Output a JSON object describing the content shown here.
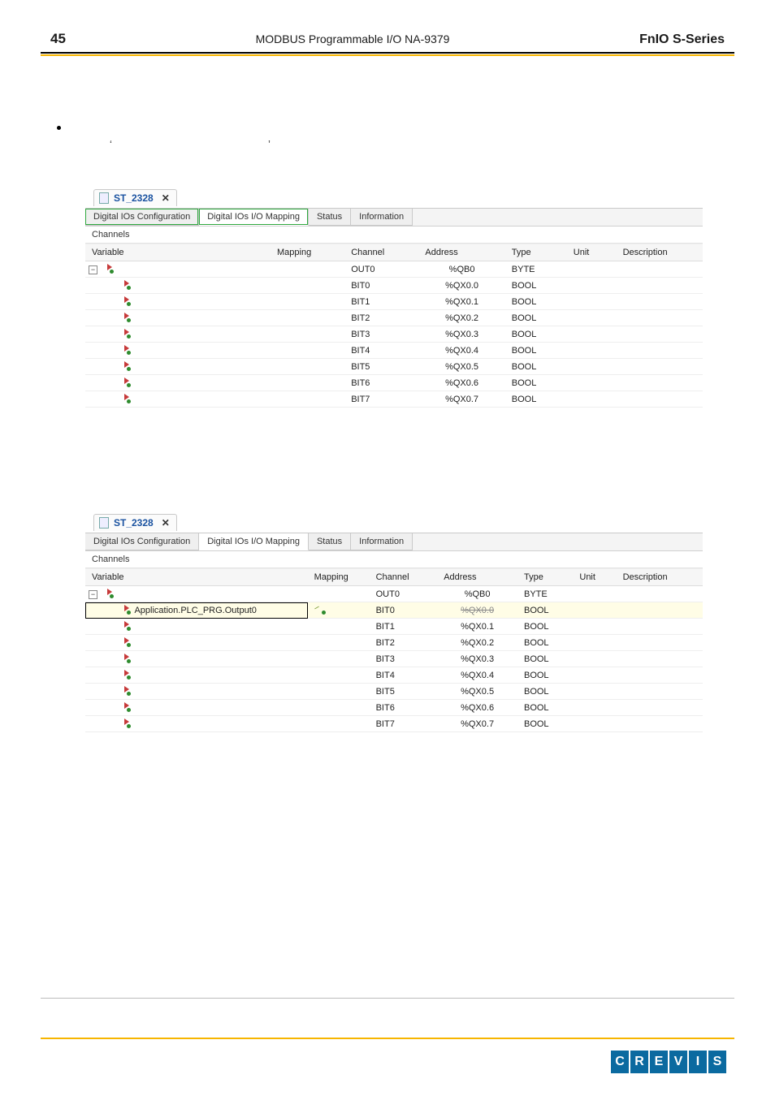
{
  "header": {
    "page_number": "45",
    "doc_title": "MODBUS Programmable I/O NA-9379",
    "series": "FnIO  S-Series"
  },
  "tabs": {
    "file_tab": "ST_2328",
    "config": "Digital IOs Configuration",
    "mapping": "Digital IOs I/O Mapping",
    "status": "Status",
    "info": "Information"
  },
  "section_label": "Channels",
  "columns": {
    "variable": "Variable",
    "mapping": "Mapping",
    "channel": "Channel",
    "address": "Address",
    "type": "Type",
    "unit": "Unit",
    "description": "Description"
  },
  "table1": {
    "parent": {
      "channel": "OUT0",
      "address": "%QB0",
      "type": "BYTE"
    },
    "rows": [
      {
        "channel": "BIT0",
        "address": "%QX0.0",
        "type": "BOOL"
      },
      {
        "channel": "BIT1",
        "address": "%QX0.1",
        "type": "BOOL"
      },
      {
        "channel": "BIT2",
        "address": "%QX0.2",
        "type": "BOOL"
      },
      {
        "channel": "BIT3",
        "address": "%QX0.3",
        "type": "BOOL"
      },
      {
        "channel": "BIT4",
        "address": "%QX0.4",
        "type": "BOOL"
      },
      {
        "channel": "BIT5",
        "address": "%QX0.5",
        "type": "BOOL"
      },
      {
        "channel": "BIT6",
        "address": "%QX0.6",
        "type": "BOOL"
      },
      {
        "channel": "BIT7",
        "address": "%QX0.7",
        "type": "BOOL"
      }
    ]
  },
  "table2": {
    "parent": {
      "channel": "OUT0",
      "address": "%QB0",
      "type": "BYTE"
    },
    "rows": [
      {
        "variable": "Application.PLC_PRG.Output0",
        "channel": "BIT0",
        "address": "%QX0.0",
        "type": "BOOL",
        "struck": true,
        "highlight": true,
        "mapped": true
      },
      {
        "channel": "BIT1",
        "address": "%QX0.1",
        "type": "BOOL"
      },
      {
        "channel": "BIT2",
        "address": "%QX0.2",
        "type": "BOOL"
      },
      {
        "channel": "BIT3",
        "address": "%QX0.3",
        "type": "BOOL"
      },
      {
        "channel": "BIT4",
        "address": "%QX0.4",
        "type": "BOOL"
      },
      {
        "channel": "BIT5",
        "address": "%QX0.5",
        "type": "BOOL"
      },
      {
        "channel": "BIT6",
        "address": "%QX0.6",
        "type": "BOOL"
      },
      {
        "channel": "BIT7",
        "address": "%QX0.7",
        "type": "BOOL"
      }
    ]
  },
  "logo_chars": [
    "C",
    "R",
    "E",
    "V",
    "I",
    "S"
  ]
}
